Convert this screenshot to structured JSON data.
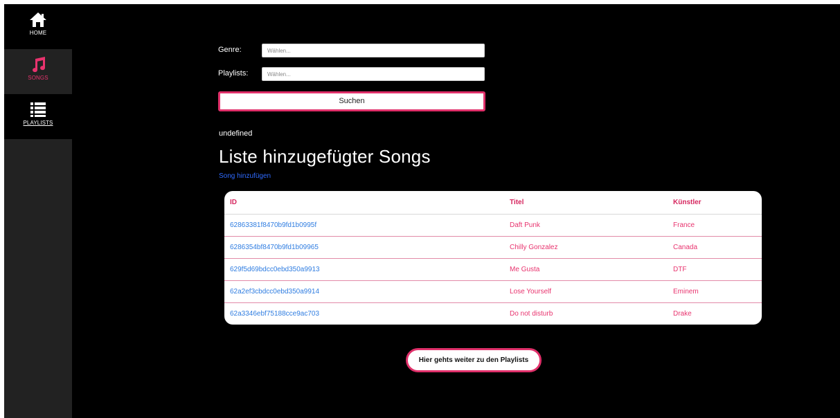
{
  "sidebar": {
    "items": [
      {
        "label": "HOME",
        "icon": "home-icon"
      },
      {
        "label": "SONGS",
        "icon": "music-note-icon",
        "active": true
      },
      {
        "label": "PLAYLISTS",
        "icon": "list-icon"
      }
    ]
  },
  "form": {
    "genre_label": "Genre:",
    "genre_placeholder": "Wählen...",
    "playlists_label": "Playlists:",
    "playlists_placeholder": "Wählen...",
    "search_label": "Suchen"
  },
  "status_text": "undefined",
  "main": {
    "title": "Liste hinzugefügter Songs",
    "add_link": "Song hinzufügen"
  },
  "table": {
    "headers": [
      "ID",
      "Titel",
      "Künstler"
    ],
    "rows": [
      [
        "62863381f8470b9fd1b0995f",
        "Daft Punk",
        "France"
      ],
      [
        "6286354bf8470b9fd1b09965",
        "Chilly Gonzalez",
        "Canada"
      ],
      [
        "629f5d69bdcc0ebd350a9913",
        "Me Gusta",
        "DTF"
      ],
      [
        "62a2ef3cbdcc0ebd350a9914",
        "Lose Yourself",
        "Eminem"
      ],
      [
        "62a3346ebf75188cce9ac703",
        "Do not disturb",
        "Drake"
      ]
    ]
  },
  "footer_button": "Hier gehts weiter zu den Playlists",
  "colors": {
    "accent": "#e0306a",
    "link": "#2f6bff",
    "background": "#000000",
    "sidebar": "#222222"
  }
}
